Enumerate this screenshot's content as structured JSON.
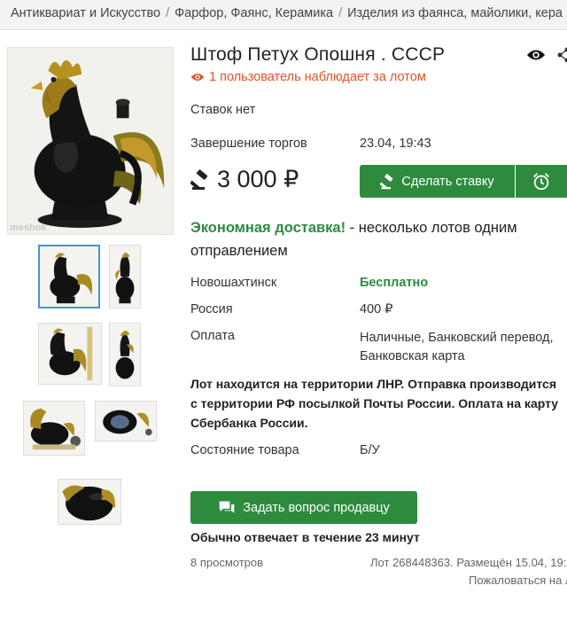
{
  "breadcrumbs": [
    "Антиквариат и Искусство",
    "Фарфор, Фаянс, Керамика",
    "Изделия из фаянса, майолики, кера"
  ],
  "breadcrumb_separator": "/",
  "gallery": {
    "watermark": "meshok",
    "thumbnail_count": 7
  },
  "lot": {
    "title": "Штоф Петух Опошня . СССР",
    "watchers_text": "1 пользователь наблюдает за лотом",
    "bids_text": "Ставок нет",
    "end_label": "Завершение торгов",
    "end_value": "23.04, 19:43",
    "price": "3 000 ₽",
    "bid_button": "Сделать ставку",
    "economy_highlight": "Экономная доставка!",
    "economy_rest": " - несколько лотов одним отправлением",
    "delivery": [
      {
        "label": "Новошахтинск",
        "value": "Бесплатно"
      },
      {
        "label": "Россия",
        "value": "400 ₽"
      },
      {
        "label": "Оплата",
        "value": "Наличные, Банковский перевод, Банковская карта"
      }
    ],
    "notice": "Лот находится на территории ЛНР. Отправка производится с территории РФ посылкой Почты России. Оплата на карту Сбербанка России.",
    "condition_label": "Состояние товара",
    "condition_value": "Б/У",
    "ask_button": "Задать вопрос продавцу",
    "reply_time": "Обычно отвечает в течение 23 минут",
    "views": "8 просмотров",
    "lot_info": "Лот 268448363. Размещён 15.04, 19:",
    "complain": "Пожаловаться на л"
  },
  "colors": {
    "accent_green": "#2e8b3e",
    "watchers_orange": "#e0542a"
  }
}
